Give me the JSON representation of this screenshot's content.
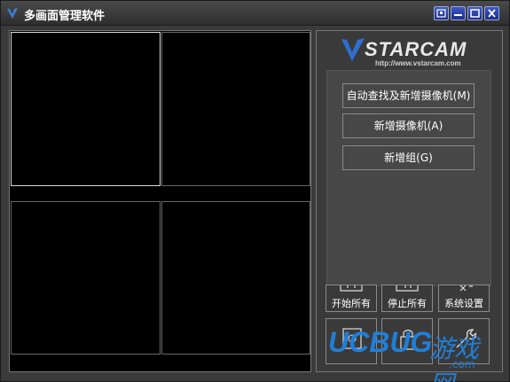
{
  "window": {
    "title": "多画面管理软件"
  },
  "logo": {
    "brand": "STARCAM",
    "url": "http://www.vstarcam.com"
  },
  "actions": [
    {
      "label": "自动查找及新增摄像机(M)"
    },
    {
      "label": "新增摄像机(A)"
    },
    {
      "label": "新增组(G)"
    }
  ],
  "toolbar": [
    {
      "label": "开始所有"
    },
    {
      "label": "停止所有"
    },
    {
      "label": "系统设置"
    }
  ],
  "watermark": {
    "text1": "UCBUG",
    "text2": "游戏网",
    "text3": ".com"
  },
  "colors": {
    "accent": "#1f7fd8",
    "titlebar_btn": "#2a43b0"
  }
}
